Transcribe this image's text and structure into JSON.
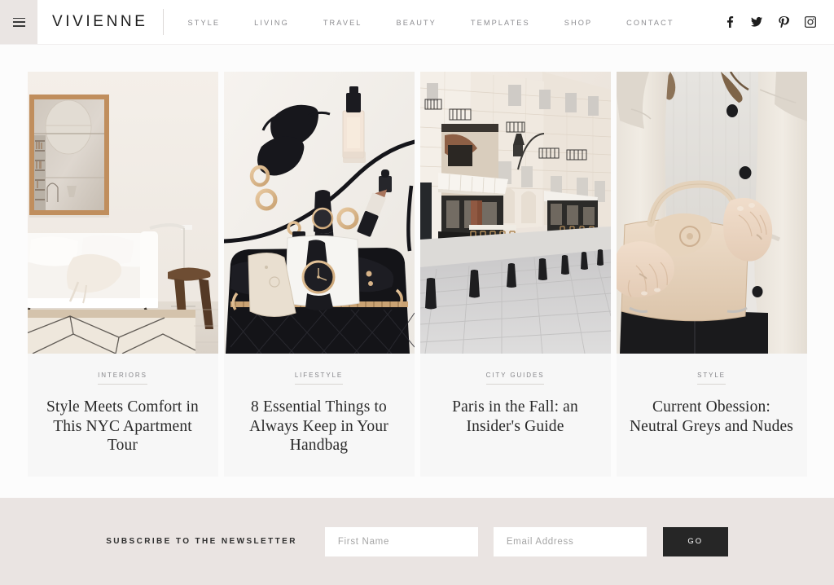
{
  "header": {
    "menu_icon": "hamburger-icon",
    "brand": "VIVIENNE",
    "nav": [
      {
        "label": "STYLE"
      },
      {
        "label": "LIVING"
      },
      {
        "label": "TRAVEL"
      },
      {
        "label": "BEAUTY"
      },
      {
        "label": "TEMPLATES"
      },
      {
        "label": "SHOP"
      },
      {
        "label": "CONTACT"
      }
    ],
    "social": [
      {
        "name": "facebook-icon",
        "glyph": "f"
      },
      {
        "name": "twitter-icon",
        "glyph": "t"
      },
      {
        "name": "pinterest-icon",
        "glyph": "p"
      },
      {
        "name": "instagram-icon",
        "glyph": "i"
      }
    ]
  },
  "posts": [
    {
      "category": "INTERIORS",
      "title": "Style Meets Comfort in This NYC Apartment Tour",
      "image_alt": "minimal-living-room-with-wooden-mirror-white-sofa"
    },
    {
      "category": "LIFESTYLE",
      "title": "8 Essential Things to Always Keep in Your Handbag",
      "image_alt": "flatlay-black-quilted-handbag-sunglasses-watch-lipstick"
    },
    {
      "category": "CITY GUIDES",
      "title": "Paris in the Fall: an Insider's Guide",
      "image_alt": "paris-cobblestone-street-with-cafe-awnings"
    },
    {
      "category": "STYLE",
      "title": "Current Obession: Neutral Greys and Nudes",
      "image_alt": "woman-in-cream-coat-holding-nude-leather-handbag"
    }
  ],
  "newsletter": {
    "label": "SUBSCRIBE TO THE NEWSLETTER",
    "first_name_placeholder": "First Name",
    "first_name_value": "",
    "email_placeholder": "Email Address",
    "email_value": "",
    "submit_label": "GO"
  },
  "colors": {
    "page_background": "#fcfcfc",
    "header_background": "#ffffff",
    "menu_block": "#eae5e3",
    "card_background": "#f7f7f7",
    "newsletter_background": "#eae4e2",
    "button": "#262626",
    "nav_text": "#8c8c90",
    "title_text": "#2a2a2a"
  }
}
